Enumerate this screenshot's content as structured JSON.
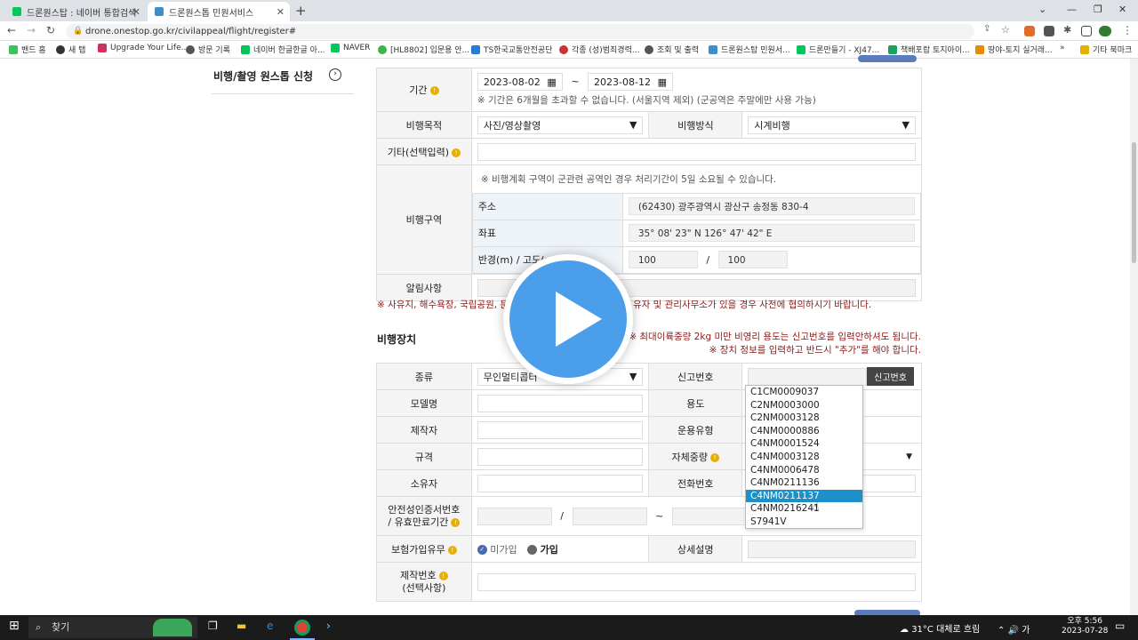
{
  "browser": {
    "tabs": [
      {
        "title": "드론원스탑 : 네이버 통합검색",
        "color": "#03c75a",
        "active": false
      },
      {
        "title": "드론원스톱 민원서비스",
        "color": "#3c8dcc",
        "active": true
      }
    ],
    "url": "drone.onestop.go.kr/civilappeal/flight/register#",
    "bookmarks": [
      {
        "label": "밴드 홈",
        "color": "#3bc45b"
      },
      {
        "label": "새 탭",
        "color": "#333333"
      },
      {
        "label": "Upgrade Your Life...",
        "color": "#d0315a"
      },
      {
        "label": "방문 기록",
        "color": "#555555"
      },
      {
        "label": "네이버 한글한글 아...",
        "color": "#03c75a"
      },
      {
        "label": "NAVER",
        "color": "#03c75a"
      },
      {
        "label": "[HL8802] 입문용 안...",
        "color": "#3bb54a"
      },
      {
        "label": "TS한국교통안전공단",
        "color": "#2a7bd4"
      },
      {
        "label": "각종 (성)범죄경력...",
        "color": "#c33"
      },
      {
        "label": "조회 및 출력",
        "color": "#555555"
      },
      {
        "label": "드론원스탑 민원서...",
        "color": "#3c8dcc"
      },
      {
        "label": "드론만들기 - XJ47...",
        "color": "#03c75a"
      },
      {
        "label": "책배포랍 토지아이...",
        "color": "#1aa260"
      },
      {
        "label": "땅야-토지 실거래...",
        "color": "#e88a00"
      },
      {
        "label": "기타 북마크",
        "color": "#e6b000"
      }
    ]
  },
  "sidebar": {
    "title": "비행/촬영 원스톱 신청",
    "arrow": "›"
  },
  "form": {
    "period_label": "기간",
    "date_start": "2023-08-02",
    "date_sep": "~",
    "date_end": "2023-08-12",
    "period_note": "※ 기간은 6개월을 초과할 수 없습니다. (서울지역 제외) (군공역은 주말에만 사용 가능)",
    "purpose_label": "비행목적",
    "purpose_value": "사진/영상촬영",
    "method_label": "비행방식",
    "method_value": "시계비행",
    "etc_label": "기타(선택입력)",
    "area_label": "비행구역",
    "area_note": "※ 비행계획 구역이 군관련 공역인 경우 처리기간이 5일 소요될 수 있습니다.",
    "address_label": "주소",
    "address_value": "(62430) 광주광역시 광산구 송정동 830-4",
    "coord_label": "좌표",
    "coord_value": "35° 08' 23\" N 126° 47' 42\" E",
    "radius_label": "반경(m) / 고도(m)",
    "radius_value": "100",
    "slash": "/",
    "altitude_value": "100",
    "notice_label": "알림사항",
    "private_note": "※ 사유지, 해수욕장, 국립공원, 문",
    "private_note2": "유자 및 관리사무소가 있을 경우 사전에 협의하시기 바랍니다."
  },
  "device": {
    "section_title": "비행장치",
    "note1": "※ 최대이륙중량 2kg 미만 비영리 용도는 신고번호를 입력안하셔도 됩니다.",
    "note2": "※ 장치 정보를 입력하고 반드시 \"추가\"를 해야 합니다.",
    "type_label": "종류",
    "type_value": "무인멀티콥터",
    "report_label": "신고번호",
    "report_button": "신고번호",
    "model_label": "모델명",
    "usage_label": "용도",
    "maker_label": "제작자",
    "operation_label": "운용유형",
    "spec_label": "규격",
    "weight_label": "자체중량",
    "owner_label": "소유자",
    "phone_label": "전화번호",
    "cert_label_1": "안전성인증서번호",
    "cert_label_2": "/ 유효만료기간",
    "cert_slash": "/",
    "cert_tilde": "~",
    "insurance_label": "보험가입유무",
    "insurance_no": "미가입",
    "insurance_yes": "가입",
    "detail_label": "상세설명",
    "serial_label_1": "제작번호",
    "serial_label_2": "(선택사항)"
  },
  "dropdown": {
    "options": [
      "C1CM0009037",
      "C2NM0003000",
      "C2NM0003128",
      "C4NM0000886",
      "C4NM0001524",
      "C4NM0003128",
      "C4NM0006478",
      "C4NM0211136",
      "C4NM0211137",
      "C4NM0216241",
      "S7941V"
    ],
    "highlighted": "C4NM0211137"
  },
  "taskbar": {
    "search": "찾기",
    "weather": "31°C 대체로 흐림",
    "time": "오후 5:56",
    "date": "2023-07-28"
  },
  "colors": {
    "accent": "#1e90c9",
    "play": "#4a9eea",
    "warning": "#8a1a1a"
  }
}
